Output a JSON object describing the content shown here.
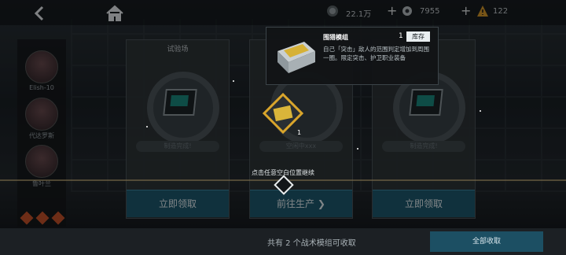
{
  "topbar": {
    "resource1_value": "22.1万",
    "resource2_value": "7955",
    "resource3_value": "122",
    "plus": "+"
  },
  "sidebar": {
    "characters": [
      {
        "name": "Elish-10"
      },
      {
        "name": "代达罗斯"
      },
      {
        "name": "鲁叶兰"
      }
    ]
  },
  "cards": [
    {
      "title": "试验场",
      "status": "制造完成!",
      "button": "立即领取"
    },
    {
      "title": "",
      "status": "空闲中xxx",
      "button": "前往生产"
    },
    {
      "title": "",
      "status": "制造完成!",
      "button": "立即领取"
    }
  ],
  "hint": "点击任意空白位置继续",
  "popup": {
    "name": "围猎模组",
    "count": "1",
    "stock_label": "库存",
    "description": "自己「突击」敌人的范围判定增加到周围一圈。限定突击、护卫职业装备"
  },
  "item_count": "1",
  "bottom": {
    "summary": "共有 2 个战术模组可收取",
    "collect_all": "全部收取"
  },
  "colors": {
    "button": "#1e5a70",
    "accent": "#d9a52b"
  }
}
